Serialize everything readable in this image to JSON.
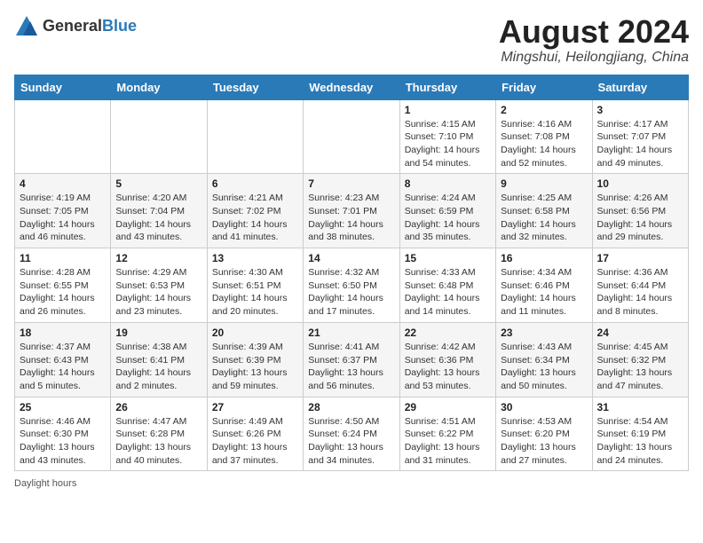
{
  "header": {
    "logo_general": "General",
    "logo_blue": "Blue",
    "month_title": "August 2024",
    "location": "Mingshui, Heilongjiang, China"
  },
  "weekdays": [
    "Sunday",
    "Monday",
    "Tuesday",
    "Wednesday",
    "Thursday",
    "Friday",
    "Saturday"
  ],
  "weeks": [
    [
      {
        "day": "",
        "info": ""
      },
      {
        "day": "",
        "info": ""
      },
      {
        "day": "",
        "info": ""
      },
      {
        "day": "",
        "info": ""
      },
      {
        "day": "1",
        "info": "Sunrise: 4:15 AM\nSunset: 7:10 PM\nDaylight: 14 hours\nand 54 minutes."
      },
      {
        "day": "2",
        "info": "Sunrise: 4:16 AM\nSunset: 7:08 PM\nDaylight: 14 hours\nand 52 minutes."
      },
      {
        "day": "3",
        "info": "Sunrise: 4:17 AM\nSunset: 7:07 PM\nDaylight: 14 hours\nand 49 minutes."
      }
    ],
    [
      {
        "day": "4",
        "info": "Sunrise: 4:19 AM\nSunset: 7:05 PM\nDaylight: 14 hours\nand 46 minutes."
      },
      {
        "day": "5",
        "info": "Sunrise: 4:20 AM\nSunset: 7:04 PM\nDaylight: 14 hours\nand 43 minutes."
      },
      {
        "day": "6",
        "info": "Sunrise: 4:21 AM\nSunset: 7:02 PM\nDaylight: 14 hours\nand 41 minutes."
      },
      {
        "day": "7",
        "info": "Sunrise: 4:23 AM\nSunset: 7:01 PM\nDaylight: 14 hours\nand 38 minutes."
      },
      {
        "day": "8",
        "info": "Sunrise: 4:24 AM\nSunset: 6:59 PM\nDaylight: 14 hours\nand 35 minutes."
      },
      {
        "day": "9",
        "info": "Sunrise: 4:25 AM\nSunset: 6:58 PM\nDaylight: 14 hours\nand 32 minutes."
      },
      {
        "day": "10",
        "info": "Sunrise: 4:26 AM\nSunset: 6:56 PM\nDaylight: 14 hours\nand 29 minutes."
      }
    ],
    [
      {
        "day": "11",
        "info": "Sunrise: 4:28 AM\nSunset: 6:55 PM\nDaylight: 14 hours\nand 26 minutes."
      },
      {
        "day": "12",
        "info": "Sunrise: 4:29 AM\nSunset: 6:53 PM\nDaylight: 14 hours\nand 23 minutes."
      },
      {
        "day": "13",
        "info": "Sunrise: 4:30 AM\nSunset: 6:51 PM\nDaylight: 14 hours\nand 20 minutes."
      },
      {
        "day": "14",
        "info": "Sunrise: 4:32 AM\nSunset: 6:50 PM\nDaylight: 14 hours\nand 17 minutes."
      },
      {
        "day": "15",
        "info": "Sunrise: 4:33 AM\nSunset: 6:48 PM\nDaylight: 14 hours\nand 14 minutes."
      },
      {
        "day": "16",
        "info": "Sunrise: 4:34 AM\nSunset: 6:46 PM\nDaylight: 14 hours\nand 11 minutes."
      },
      {
        "day": "17",
        "info": "Sunrise: 4:36 AM\nSunset: 6:44 PM\nDaylight: 14 hours\nand 8 minutes."
      }
    ],
    [
      {
        "day": "18",
        "info": "Sunrise: 4:37 AM\nSunset: 6:43 PM\nDaylight: 14 hours\nand 5 minutes."
      },
      {
        "day": "19",
        "info": "Sunrise: 4:38 AM\nSunset: 6:41 PM\nDaylight: 14 hours\nand 2 minutes."
      },
      {
        "day": "20",
        "info": "Sunrise: 4:39 AM\nSunset: 6:39 PM\nDaylight: 13 hours\nand 59 minutes."
      },
      {
        "day": "21",
        "info": "Sunrise: 4:41 AM\nSunset: 6:37 PM\nDaylight: 13 hours\nand 56 minutes."
      },
      {
        "day": "22",
        "info": "Sunrise: 4:42 AM\nSunset: 6:36 PM\nDaylight: 13 hours\nand 53 minutes."
      },
      {
        "day": "23",
        "info": "Sunrise: 4:43 AM\nSunset: 6:34 PM\nDaylight: 13 hours\nand 50 minutes."
      },
      {
        "day": "24",
        "info": "Sunrise: 4:45 AM\nSunset: 6:32 PM\nDaylight: 13 hours\nand 47 minutes."
      }
    ],
    [
      {
        "day": "25",
        "info": "Sunrise: 4:46 AM\nSunset: 6:30 PM\nDaylight: 13 hours\nand 43 minutes."
      },
      {
        "day": "26",
        "info": "Sunrise: 4:47 AM\nSunset: 6:28 PM\nDaylight: 13 hours\nand 40 minutes."
      },
      {
        "day": "27",
        "info": "Sunrise: 4:49 AM\nSunset: 6:26 PM\nDaylight: 13 hours\nand 37 minutes."
      },
      {
        "day": "28",
        "info": "Sunrise: 4:50 AM\nSunset: 6:24 PM\nDaylight: 13 hours\nand 34 minutes."
      },
      {
        "day": "29",
        "info": "Sunrise: 4:51 AM\nSunset: 6:22 PM\nDaylight: 13 hours\nand 31 minutes."
      },
      {
        "day": "30",
        "info": "Sunrise: 4:53 AM\nSunset: 6:20 PM\nDaylight: 13 hours\nand 27 minutes."
      },
      {
        "day": "31",
        "info": "Sunrise: 4:54 AM\nSunset: 6:19 PM\nDaylight: 13 hours\nand 24 minutes."
      }
    ]
  ],
  "footer": {
    "note": "Daylight hours"
  }
}
